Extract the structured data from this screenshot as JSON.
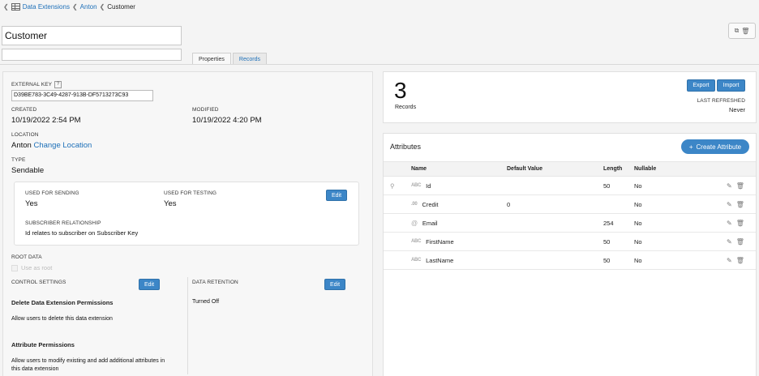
{
  "breadcrumb": {
    "items": [
      "Data Extensions",
      "Anton",
      "Customer"
    ]
  },
  "header": {
    "name_value": "Customer",
    "description_value": "",
    "tabs": [
      {
        "label": "Properties"
      },
      {
        "label": "Records"
      }
    ]
  },
  "properties": {
    "external_key_label": "EXTERNAL KEY",
    "external_key_help": "?",
    "external_key_value": "D39BE783-3C49-4287-913B-DF5713273C93",
    "created_label": "CREATED",
    "created_value": "10/19/2022 2:54 PM",
    "modified_label": "MODIFIED",
    "modified_value": "10/19/2022 4:20 PM",
    "location_label": "LOCATION",
    "location_value": "Anton",
    "change_location_link": "Change Location",
    "type_label": "TYPE",
    "type_value": "Sendable",
    "sendable": {
      "used_for_sending_label": "USED FOR SENDING",
      "used_for_sending_value": "Yes",
      "used_for_testing_label": "USED FOR TESTING",
      "used_for_testing_value": "Yes",
      "subscriber_rel_label": "SUBSCRIBER RELATIONSHIP",
      "subscriber_rel_value": "Id relates to subscriber on Subscriber Key",
      "edit_label": "Edit"
    },
    "root_data_label": "ROOT DATA",
    "use_as_root_label": "Use as root",
    "control_settings_label": "CONTROL SETTINGS",
    "control_edit_label": "Edit",
    "delete_perm_title": "Delete Data Extension Permissions",
    "delete_perm_text": "Allow users to delete this data extension",
    "attr_perm_title": "Attribute Permissions",
    "attr_perm_text_1": "Allow users to modify existing and add additional attributes in",
    "attr_perm_text_2": "this data extension",
    "data_retention_label": "DATA RETENTION",
    "retention_edit_label": "Edit",
    "data_retention_value": "Turned Off"
  },
  "records_summary": {
    "count": "3",
    "count_label": "Records",
    "export_label": "Export",
    "import_label": "Import",
    "last_refreshed_label": "LAST REFRESHED",
    "last_refreshed_value": "Never"
  },
  "attributes": {
    "title": "Attributes",
    "create_button": "Create Attribute",
    "columns": [
      "Name",
      "Default Value",
      "Length",
      "Nullable"
    ],
    "rows": [
      {
        "type_icon": "ABC",
        "name": "Id",
        "default": "",
        "length": "50",
        "nullable": "No",
        "primary_key": true
      },
      {
        "type_icon": ".00",
        "name": "Credit",
        "default": "0",
        "length": "",
        "nullable": "No",
        "primary_key": false
      },
      {
        "type_icon": "@",
        "name": "Email",
        "default": "",
        "length": "254",
        "nullable": "No",
        "primary_key": false
      },
      {
        "type_icon": "ABC",
        "name": "FirstName",
        "default": "",
        "length": "50",
        "nullable": "No",
        "primary_key": false
      },
      {
        "type_icon": "ABC",
        "name": "LastName",
        "default": "",
        "length": "50",
        "nullable": "No",
        "primary_key": false
      }
    ]
  },
  "colors": {
    "accent": "#3c86c7",
    "link": "#1c6fb8"
  }
}
